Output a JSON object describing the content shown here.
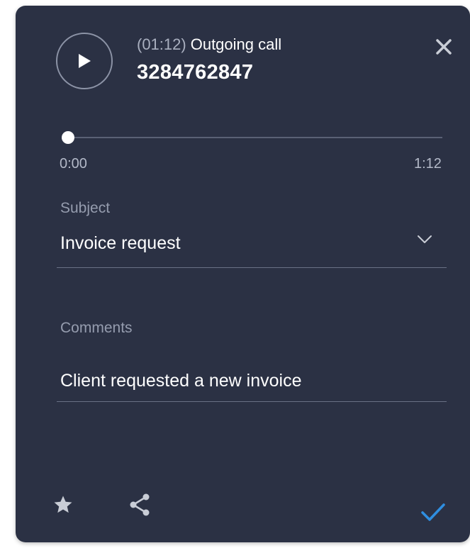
{
  "call": {
    "duration": "(01:12)",
    "type": "Outgoing call",
    "number": "3284762847"
  },
  "player": {
    "current_time": "0:00",
    "total_time": "1:12",
    "progress_fraction": 0
  },
  "subject": {
    "label": "Subject",
    "value": "Invoice request"
  },
  "comments": {
    "label": "Comments",
    "value": "Client requested a new invoice"
  },
  "icons": {
    "play": "play-icon",
    "close": "close-icon",
    "dropdown": "chevron-down-icon",
    "star": "star-icon",
    "share": "share-icon",
    "confirm": "checkmark-icon"
  },
  "colors": {
    "panel_background": "#2b3144",
    "accent_confirm": "#2f8ee0",
    "text_primary": "#ffffff",
    "text_secondary": "#959cae"
  }
}
